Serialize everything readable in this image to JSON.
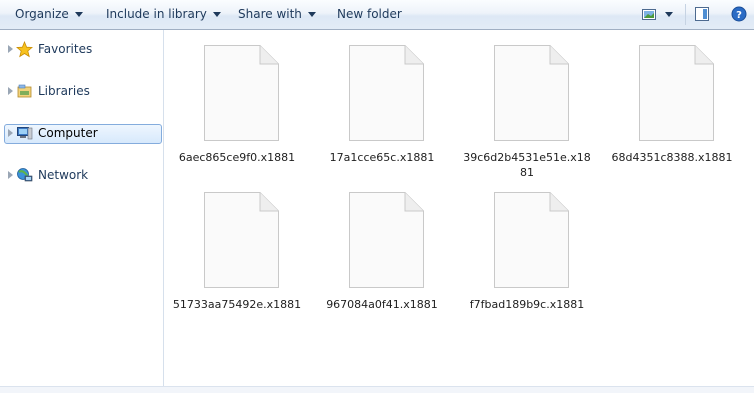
{
  "toolbar": {
    "organize": "Organize",
    "include_in_library": "Include in library",
    "share_with": "Share with",
    "new_folder": "New folder",
    "help_label": "?"
  },
  "sidebar": {
    "items": [
      {
        "label": "Favorites",
        "icon": "star-icon"
      },
      {
        "label": "Libraries",
        "icon": "libraries-icon"
      },
      {
        "label": "Computer",
        "icon": "computer-icon",
        "selected": true
      },
      {
        "label": "Network",
        "icon": "network-icon"
      }
    ]
  },
  "files": [
    {
      "name": "6aec865ce9f0.x1881"
    },
    {
      "name": "17a1cce65c.x1881"
    },
    {
      "name": "39c6d2b4531e51e.x1881"
    },
    {
      "name": "68d4351c8388.x1881"
    },
    {
      "name": "51733aa75492e.x1881"
    },
    {
      "name": "967084a0f41.x1881"
    },
    {
      "name": "f7fbad189b9c.x1881"
    }
  ],
  "colors": {
    "toolbar_text": "#1e395b",
    "selection_border": "#84acdd",
    "selection_fill": "#d7e9fc"
  }
}
